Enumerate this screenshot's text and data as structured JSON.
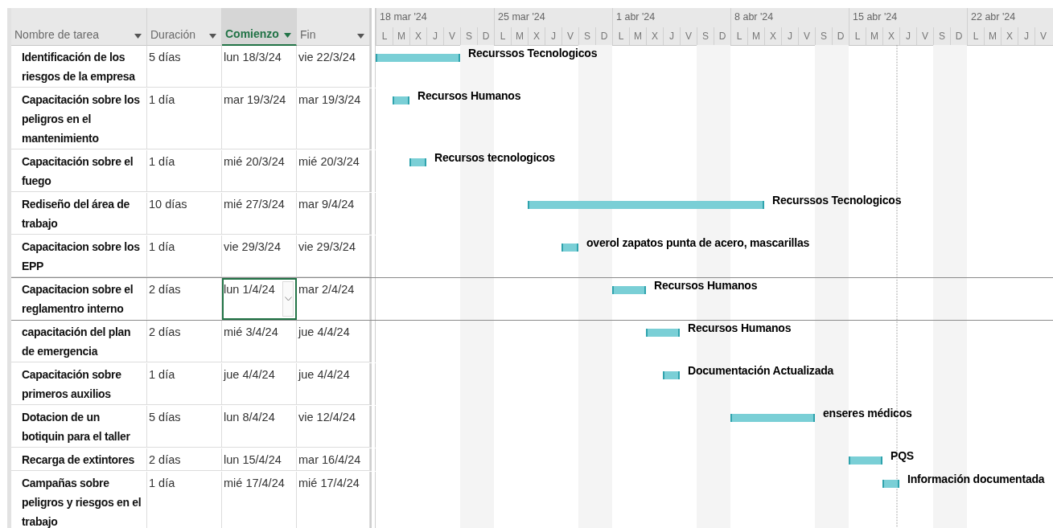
{
  "columns": [
    {
      "label": "Nombre de tarea",
      "selected": false
    },
    {
      "label": "Duración",
      "selected": false
    },
    {
      "label": "Comienzo",
      "selected": true
    },
    {
      "label": "Fin",
      "selected": false
    }
  ],
  "timeline": {
    "weeks": [
      {
        "label": "18 mar '24",
        "days": [
          {
            "letter": "L",
            "weekend": false
          },
          {
            "letter": "M",
            "weekend": false
          },
          {
            "letter": "X",
            "weekend": false
          },
          {
            "letter": "J",
            "weekend": false
          },
          {
            "letter": "V",
            "weekend": false
          },
          {
            "letter": "S",
            "weekend": true
          },
          {
            "letter": "D",
            "weekend": true
          }
        ]
      },
      {
        "label": "25 mar '24",
        "days": [
          {
            "letter": "L",
            "weekend": false
          },
          {
            "letter": "M",
            "weekend": false
          },
          {
            "letter": "X",
            "weekend": false
          },
          {
            "letter": "J",
            "weekend": false
          },
          {
            "letter": "V",
            "weekend": false
          },
          {
            "letter": "S",
            "weekend": true
          },
          {
            "letter": "D",
            "weekend": true
          }
        ]
      },
      {
        "label": "1 abr '24",
        "days": [
          {
            "letter": "L",
            "weekend": false
          },
          {
            "letter": "M",
            "weekend": false
          },
          {
            "letter": "X",
            "weekend": false
          },
          {
            "letter": "J",
            "weekend": false
          },
          {
            "letter": "V",
            "weekend": false
          },
          {
            "letter": "S",
            "weekend": true
          },
          {
            "letter": "D",
            "weekend": true
          }
        ]
      },
      {
        "label": "8 abr '24",
        "days": [
          {
            "letter": "L",
            "weekend": false
          },
          {
            "letter": "M",
            "weekend": false
          },
          {
            "letter": "X",
            "weekend": false
          },
          {
            "letter": "J",
            "weekend": false
          },
          {
            "letter": "V",
            "weekend": false
          },
          {
            "letter": "S",
            "weekend": true
          },
          {
            "letter": "D",
            "weekend": true
          }
        ]
      },
      {
        "label": "15 abr '24",
        "days": [
          {
            "letter": "L",
            "weekend": false
          },
          {
            "letter": "M",
            "weekend": false
          },
          {
            "letter": "X",
            "weekend": false
          },
          {
            "letter": "J",
            "weekend": false
          },
          {
            "letter": "V",
            "weekend": false
          },
          {
            "letter": "S",
            "weekend": true
          },
          {
            "letter": "D",
            "weekend": true
          }
        ]
      },
      {
        "label": "22 abr '24",
        "days": [
          {
            "letter": "L",
            "weekend": false
          },
          {
            "letter": "M",
            "weekend": false
          },
          {
            "letter": "X",
            "weekend": false
          },
          {
            "letter": "J",
            "weekend": false
          },
          {
            "letter": "V",
            "weekend": false
          }
        ]
      }
    ]
  },
  "rows": [
    {
      "name": "Identificación de los riesgos de la empresa",
      "duration": "5 días",
      "start": "lun 18/3/24",
      "end": "vie 22/3/24",
      "resource": "Recurssos Tecnologicos",
      "selected": false
    },
    {
      "name": "Capacitación sobre los peligros en el mantenimiento",
      "duration": "1 día",
      "start": "mar 19/3/24",
      "end": "mar 19/3/24",
      "resource": "Recursos Humanos",
      "selected": false
    },
    {
      "name": "Capacitación sobre el fuego",
      "duration": "1 día",
      "start": "mié 20/3/24",
      "end": "mié 20/3/24",
      "resource": "Recursos tecnologicos",
      "selected": false
    },
    {
      "name": "Rediseño del área de trabajo",
      "duration": "10 días",
      "start": "mié 27/3/24",
      "end": "mar 9/4/24",
      "resource": "Recurssos Tecnologicos",
      "selected": false
    },
    {
      "name": "Capacitacion sobre los EPP",
      "duration": "1 día",
      "start": "vie 29/3/24",
      "end": "vie 29/3/24",
      "resource": "overol zapatos punta de acero, mascarillas",
      "selected": false
    },
    {
      "name": "Capacitacion sobre el reglamentro interno",
      "duration": "2 días",
      "start": "lun 1/4/24",
      "end": "mar 2/4/24",
      "resource": "Recursos Humanos",
      "selected": true
    },
    {
      "name": "capacitación del plan de emergencia",
      "duration": "2 días",
      "start": "mié 3/4/24",
      "end": "jue 4/4/24",
      "resource": "Recursos Humanos",
      "selected": false
    },
    {
      "name": "Capacitación sobre primeros auxilios",
      "duration": "1 día",
      "start": "jue 4/4/24",
      "end": "jue 4/4/24",
      "resource": "Documentación Actualizada",
      "selected": false
    },
    {
      "name": "Dotacion de un botiquin para el taller",
      "duration": "5 días",
      "start": "lun 8/4/24",
      "end": "vie 12/4/24",
      "resource": "enseres médicos",
      "selected": false
    },
    {
      "name": "Recarga de extintores",
      "duration": "2 días",
      "start": "lun 15/4/24",
      "end": "mar 16/4/24",
      "resource": "PQS",
      "selected": false
    },
    {
      "name": "Campañas sobre peligros y riesgos en el trabajo",
      "duration": "1 día",
      "start": "mié 17/4/24",
      "end": "mié 17/4/24",
      "resource": "Información documentada",
      "selected": false
    }
  ]
}
